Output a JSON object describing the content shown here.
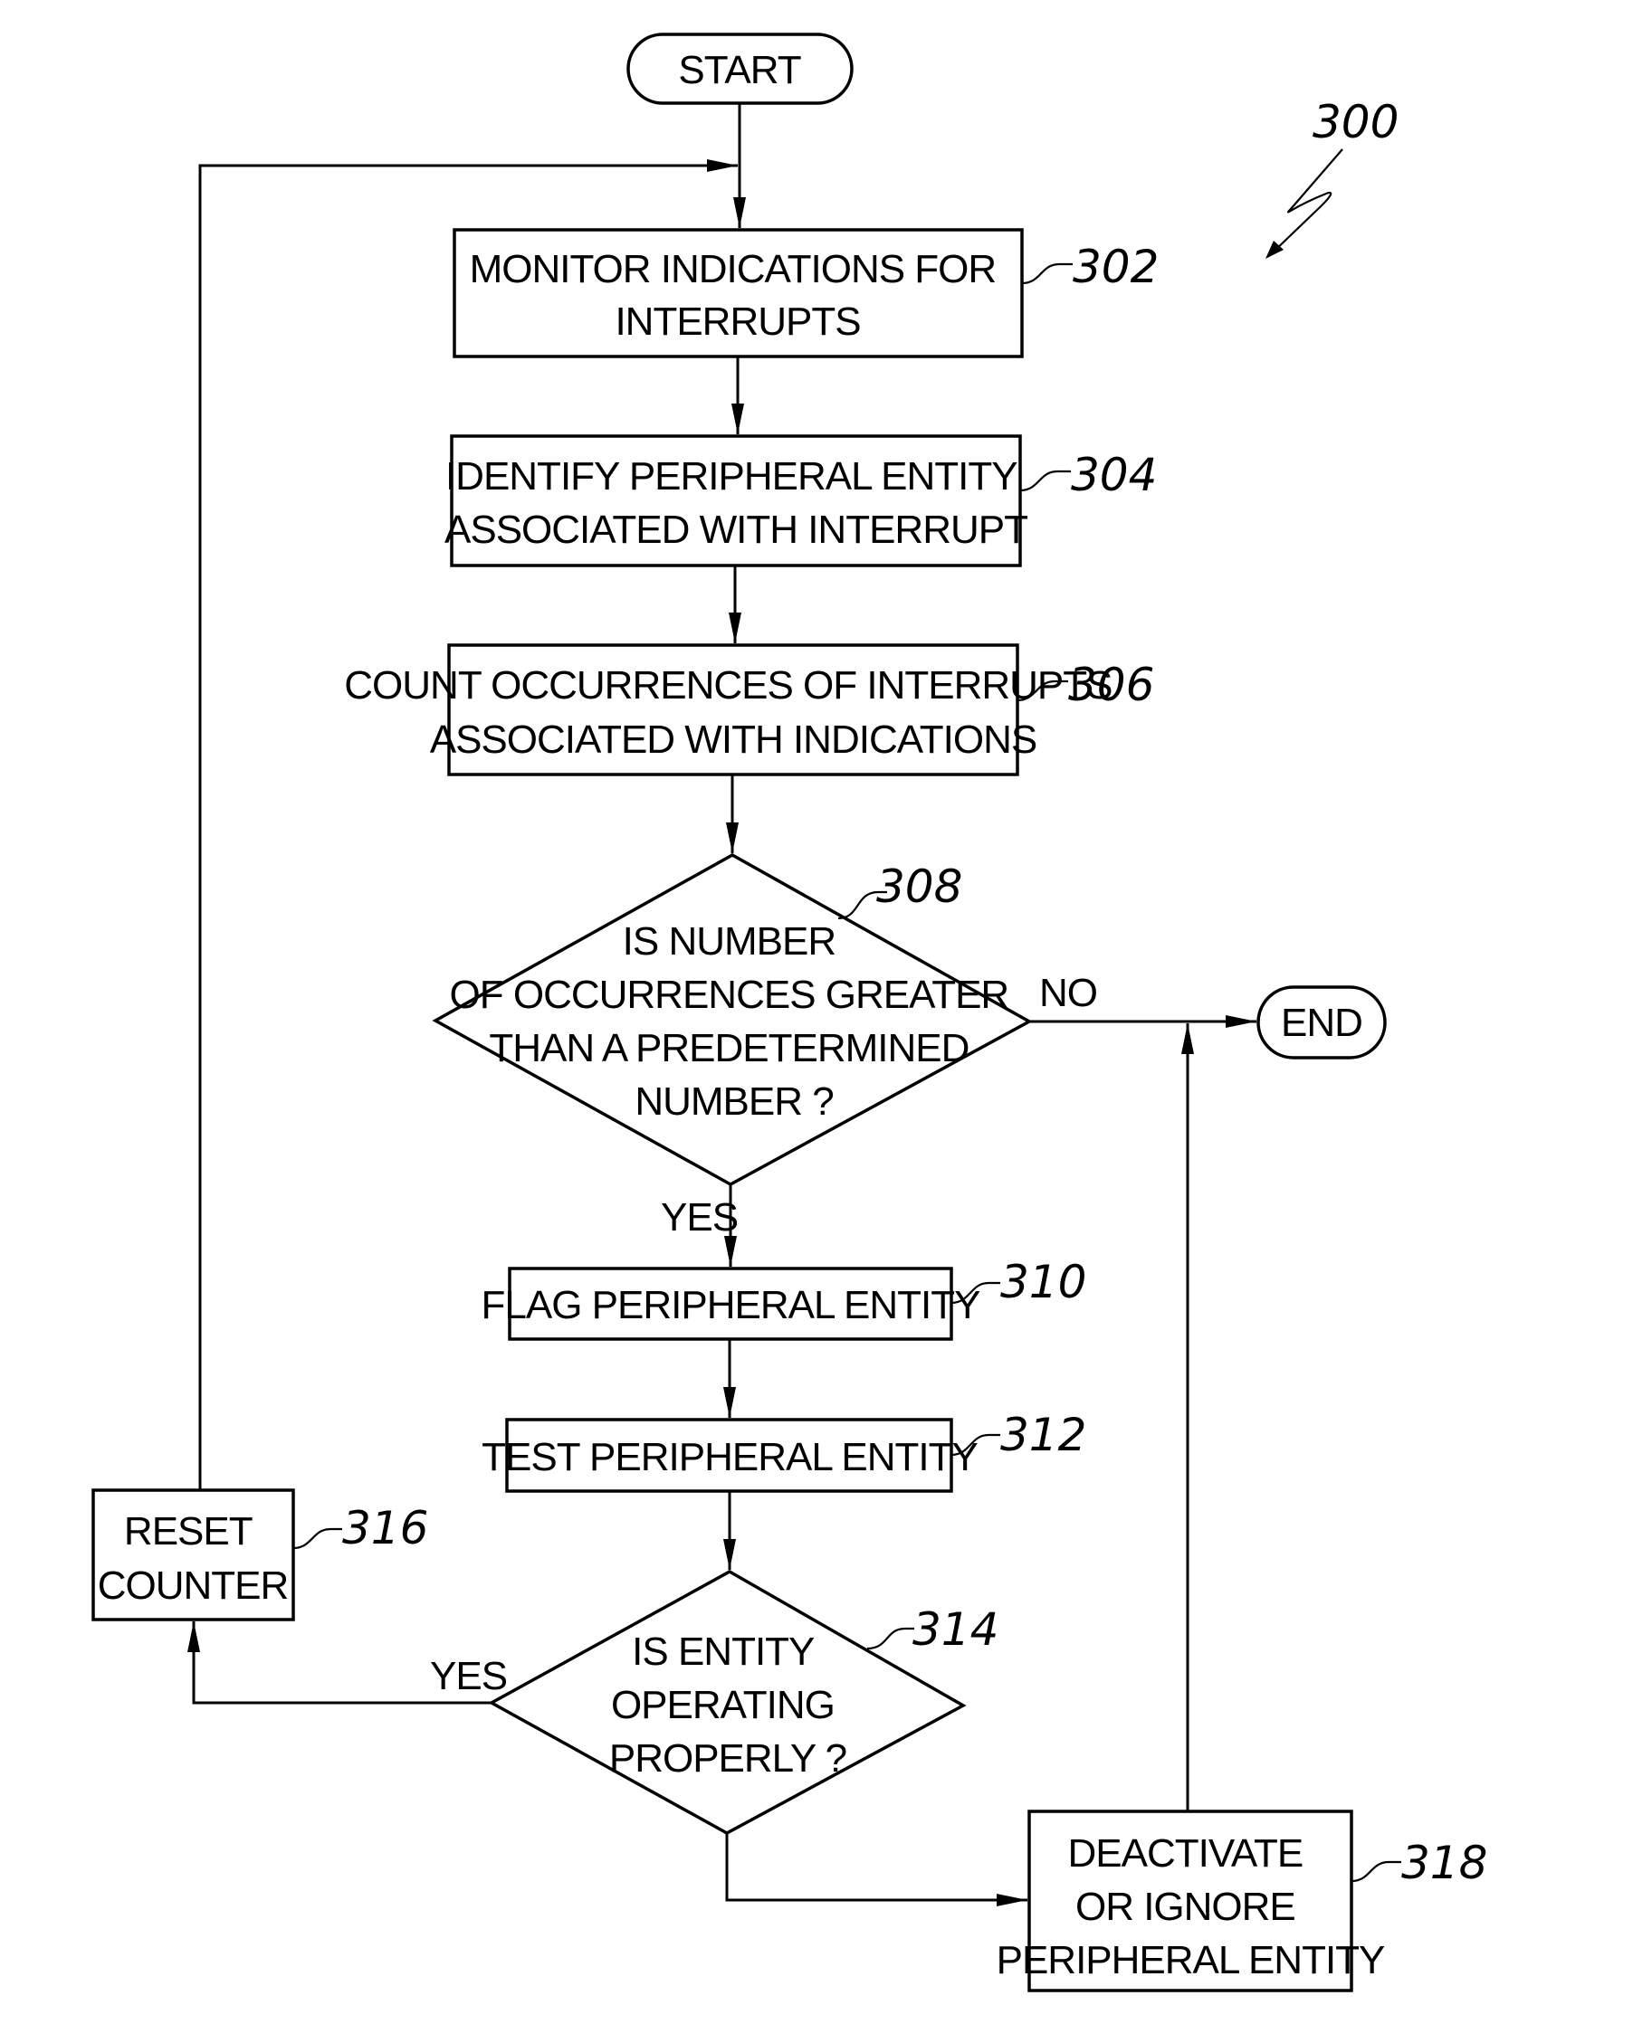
{
  "figure": {
    "reference": "300",
    "type": "flowchart"
  },
  "nodes": {
    "start": {
      "label": "START"
    },
    "end": {
      "label": "END"
    },
    "n302": {
      "ref": "302",
      "lines": [
        "MONITOR INDICATIONS FOR",
        "INTERRUPTS"
      ]
    },
    "n304": {
      "ref": "304",
      "lines": [
        "IDENTIFY PERIPHERAL ENTITY",
        "ASSOCIATED WITH INTERRUPT"
      ]
    },
    "n306": {
      "ref": "306",
      "lines": [
        "COUNT OCCURRENCES OF INTERRUPTS",
        "ASSOCIATED WITH INDICATIONS"
      ]
    },
    "n308": {
      "ref": "308",
      "lines": [
        "IS NUMBER",
        "OF OCCURRENCES GREATER",
        "THAN A PREDETERMINED",
        "NUMBER ?"
      ]
    },
    "n310": {
      "ref": "310",
      "lines": [
        "FLAG PERIPHERAL ENTITY"
      ]
    },
    "n312": {
      "ref": "312",
      "lines": [
        "TEST PERIPHERAL ENTITY"
      ]
    },
    "n314": {
      "ref": "314",
      "lines": [
        "IS ENTITY",
        "OPERATING",
        "PROPERLY ?"
      ]
    },
    "n316": {
      "ref": "316",
      "lines": [
        "RESET",
        "COUNTER"
      ]
    },
    "n318": {
      "ref": "318",
      "lines": [
        "DEACTIVATE",
        "OR IGNORE",
        "PERIPHERAL ENTITY"
      ]
    }
  },
  "edges": {
    "e308_no": {
      "label": "NO"
    },
    "e308_yes": {
      "label": "YES"
    },
    "e314_yes": {
      "label": "YES"
    }
  }
}
